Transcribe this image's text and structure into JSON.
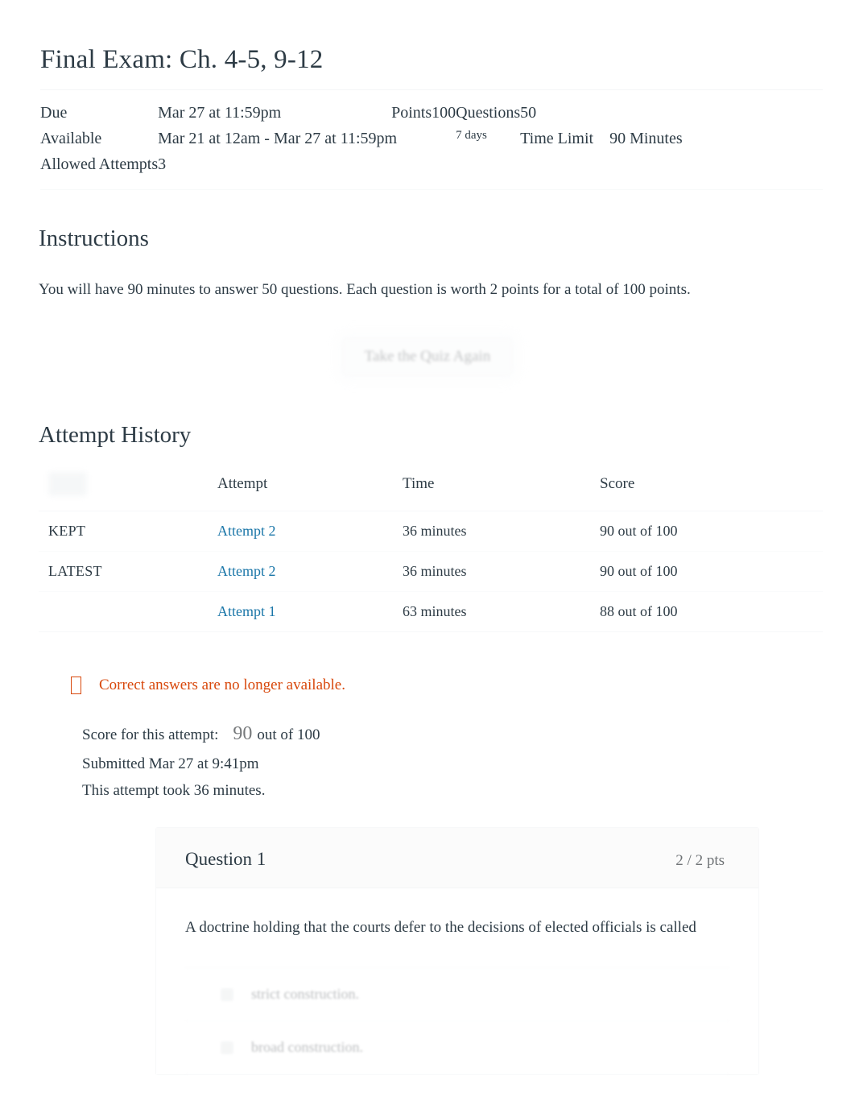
{
  "quiz": {
    "title": "Final Exam: Ch. 4-5, 9-12",
    "meta": {
      "due_label": "Due",
      "due_value": "Mar 27 at 11:59pm",
      "points_label": "Points",
      "points_value": "100",
      "questions_label": "Questions",
      "questions_value": "50",
      "available_label": "Available",
      "available_value": "Mar 21 at 12am - Mar 27 at 11:59pm",
      "available_duration": "7 days",
      "time_limit_label": "Time Limit",
      "time_limit_value": "90 Minutes",
      "allowed_attempts_label": "Allowed Attempts",
      "allowed_attempts_value": "3"
    }
  },
  "instructions": {
    "heading": "Instructions",
    "body": "You will have 90 minutes to answer 50 questions. Each question is worth 2 points for a total of 100 points."
  },
  "retake": {
    "label": "Take the Quiz Again"
  },
  "attempt_history": {
    "heading": "Attempt History",
    "columns": {
      "flag": "",
      "attempt": "Attempt",
      "time": "Time",
      "score": "Score"
    },
    "rows": [
      {
        "flag": "KEPT",
        "attempt": "Attempt 2",
        "time": "36 minutes",
        "score": "90 out of 100"
      },
      {
        "flag": "LATEST",
        "attempt": "Attempt 2",
        "time": "36 minutes",
        "score": "90 out of 100"
      },
      {
        "flag": "",
        "attempt": "Attempt 1",
        "time": "63 minutes",
        "score": "88 out of 100"
      }
    ]
  },
  "alert": {
    "icon": "warning-icon",
    "text": "Correct answers are no longer available.",
    "color": "#d8480c"
  },
  "score_summary": {
    "score_label": "Score for this attempt:",
    "score_value": "90",
    "score_suffix": "out of 100",
    "submitted": "Submitted Mar 27 at 9:41pm",
    "duration": "This attempt took 36 minutes."
  },
  "question": {
    "name": "Question 1",
    "points": "2 / 2 pts",
    "text": "A doctrine holding that the courts defer to the decisions of elected officials is called",
    "answers": [
      {
        "text": "strict construction."
      },
      {
        "text": "broad construction."
      }
    ]
  },
  "colors": {
    "link": "#1a76a8",
    "text": "#2d3b45",
    "alert": "#d8480c"
  }
}
